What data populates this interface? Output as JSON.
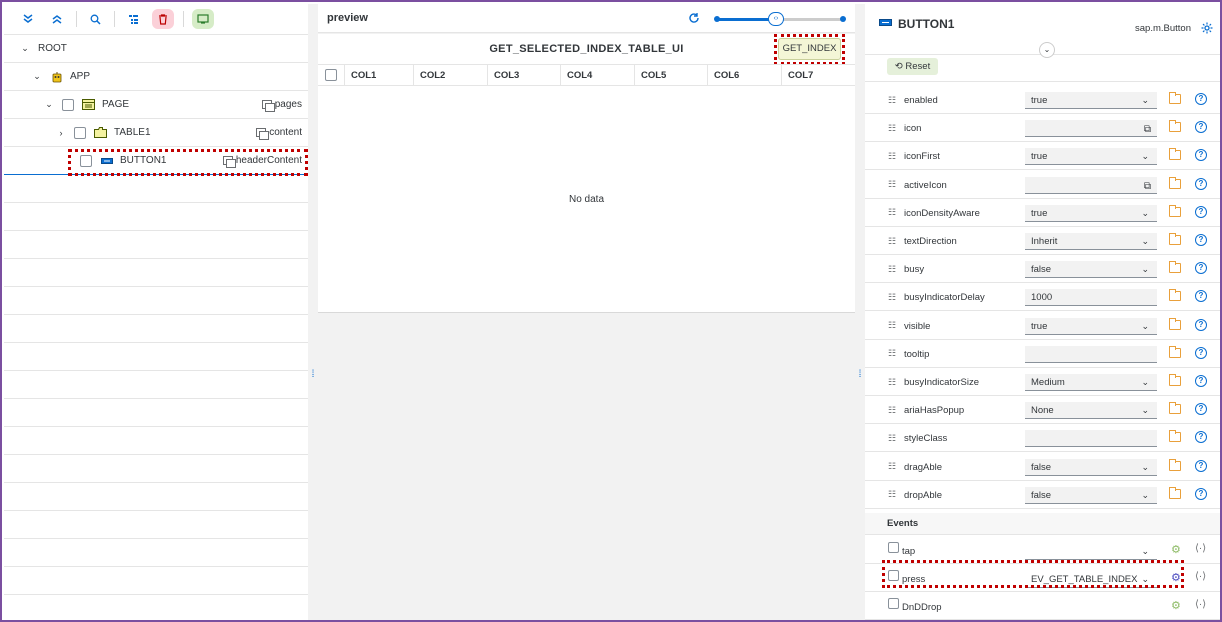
{
  "toolbar": {
    "expand_all_icon": "chevrons-down-icon",
    "collapse_all_icon": "chevrons-up-icon",
    "search_icon": "search-icon",
    "tree_icon": "tree-list-icon",
    "delete_icon": "trash-icon",
    "preview_icon": "screen-icon"
  },
  "tree": {
    "root": "ROOT",
    "app": "APP",
    "page": "PAGE",
    "page_agg": "pages",
    "table": "TABLE1",
    "table_agg": "content",
    "button": "BUTTON1",
    "button_agg": "headerContent"
  },
  "preview": {
    "title": "preview",
    "table_title": "GET_SELECTED_INDEX_TABLE_UI",
    "button_label": "GET_INDEX",
    "columns": [
      "COL1",
      "COL2",
      "COL3",
      "COL4",
      "COL5",
      "COL6",
      "COL7"
    ],
    "no_data": "No data",
    "slider_handle": "‹›"
  },
  "properties": {
    "title": "BUTTON1",
    "class_name": "sap.m.Button",
    "reset_label": "Reset",
    "rows": [
      {
        "name": "enabled",
        "value": "true",
        "type": "select"
      },
      {
        "name": "icon",
        "value": "",
        "type": "valuehelp"
      },
      {
        "name": "iconFirst",
        "value": "true",
        "type": "select"
      },
      {
        "name": "activeIcon",
        "value": "",
        "type": "valuehelp"
      },
      {
        "name": "iconDensityAware",
        "value": "true",
        "type": "select"
      },
      {
        "name": "textDirection",
        "value": "Inherit",
        "type": "select"
      },
      {
        "name": "busy",
        "value": "false",
        "type": "select"
      },
      {
        "name": "busyIndicatorDelay",
        "value": "1000",
        "type": "input"
      },
      {
        "name": "visible",
        "value": "true",
        "type": "select"
      },
      {
        "name": "tooltip",
        "value": "",
        "type": "input"
      },
      {
        "name": "busyIndicatorSize",
        "value": "Medium",
        "type": "select"
      },
      {
        "name": "ariaHasPopup",
        "value": "None",
        "type": "select"
      },
      {
        "name": "styleClass",
        "value": "",
        "type": "input"
      },
      {
        "name": "dragAble",
        "value": "false",
        "type": "select"
      },
      {
        "name": "dropAble",
        "value": "false",
        "type": "select"
      }
    ],
    "events_label": "Events",
    "events": [
      {
        "name": "tap",
        "value": "",
        "has_select": true,
        "active": false
      },
      {
        "name": "press",
        "value": "EV_GET_TABLE_INDEX",
        "has_select": true,
        "active": true
      },
      {
        "name": "DnDDrop",
        "value": "",
        "has_select": false,
        "active": false
      }
    ]
  },
  "colors": {
    "accent": "#0a6ed1",
    "highlight": "#c00000",
    "frame": "#7b4fa0"
  }
}
